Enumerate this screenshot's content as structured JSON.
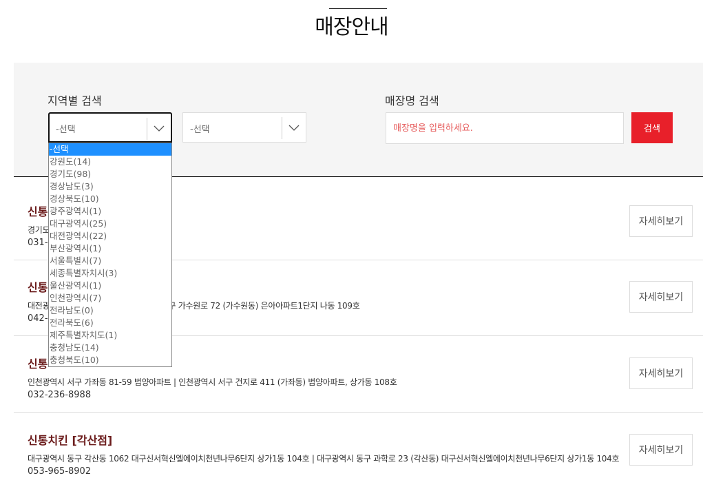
{
  "page": {
    "title": "매장안내"
  },
  "search": {
    "region_label": "지역별 검색",
    "store_label": "매장명 검색",
    "region_select_value": "-선택",
    "district_select_value": "-선택",
    "store_placeholder": "매장명을 입력하세요.",
    "search_button": "검색"
  },
  "region_options": [
    "-선택",
    "강원도(14)",
    "경기도(98)",
    "경상남도(3)",
    "경상북도(10)",
    "광주광역시(1)",
    "대구광역시(25)",
    "대전광역시(22)",
    "부산광역시(1)",
    "서울특별시(7)",
    "세종특별자치시(3)",
    "울산광역시(1)",
    "인천광역시(7)",
    "전라남도(0)",
    "전라북도(6)",
    "제주특별자치도(1)",
    "충청남도(14)",
    "충청북도(10)"
  ],
  "stores": [
    {
      "name": "신통",
      "addr": "경기도                                                   여주시 가남읍 태평로 44",
      "tel": "031-",
      "detail": "자세히보기"
    },
    {
      "name": "신통",
      "addr": "대전광                                                  1단지 나동 109호 | 대전광역시 서구 가수원로 72 (가수원동) 은아아파트1단지 나동 109호",
      "tel": "042-",
      "detail": "자세히보기"
    },
    {
      "name": "신통",
      "addr": "인천광역시 서구 가좌동 81-59 범양아파트 | 인천광역시 서구 건지로 411 (가좌동) 범양아파트, 상가동 108호",
      "tel": "032-236-8988",
      "detail": "자세히보기"
    },
    {
      "name": "신통치킨 [각산점]",
      "addr": "대구광역시 동구 각산동 1062 대구신서혁신엘에이치천년나무6단지 상가1동 104호 | 대구광역시 동구 과학로 23 (각산동) 대구신서혁신엘에이치천년나무6단지 상가1동 104호",
      "tel": "053-965-8902",
      "detail": "자세히보기"
    }
  ],
  "colors": {
    "accent": "#e8202a",
    "store_name": "#6b1b1b",
    "selected_option": "#1e90ff"
  }
}
